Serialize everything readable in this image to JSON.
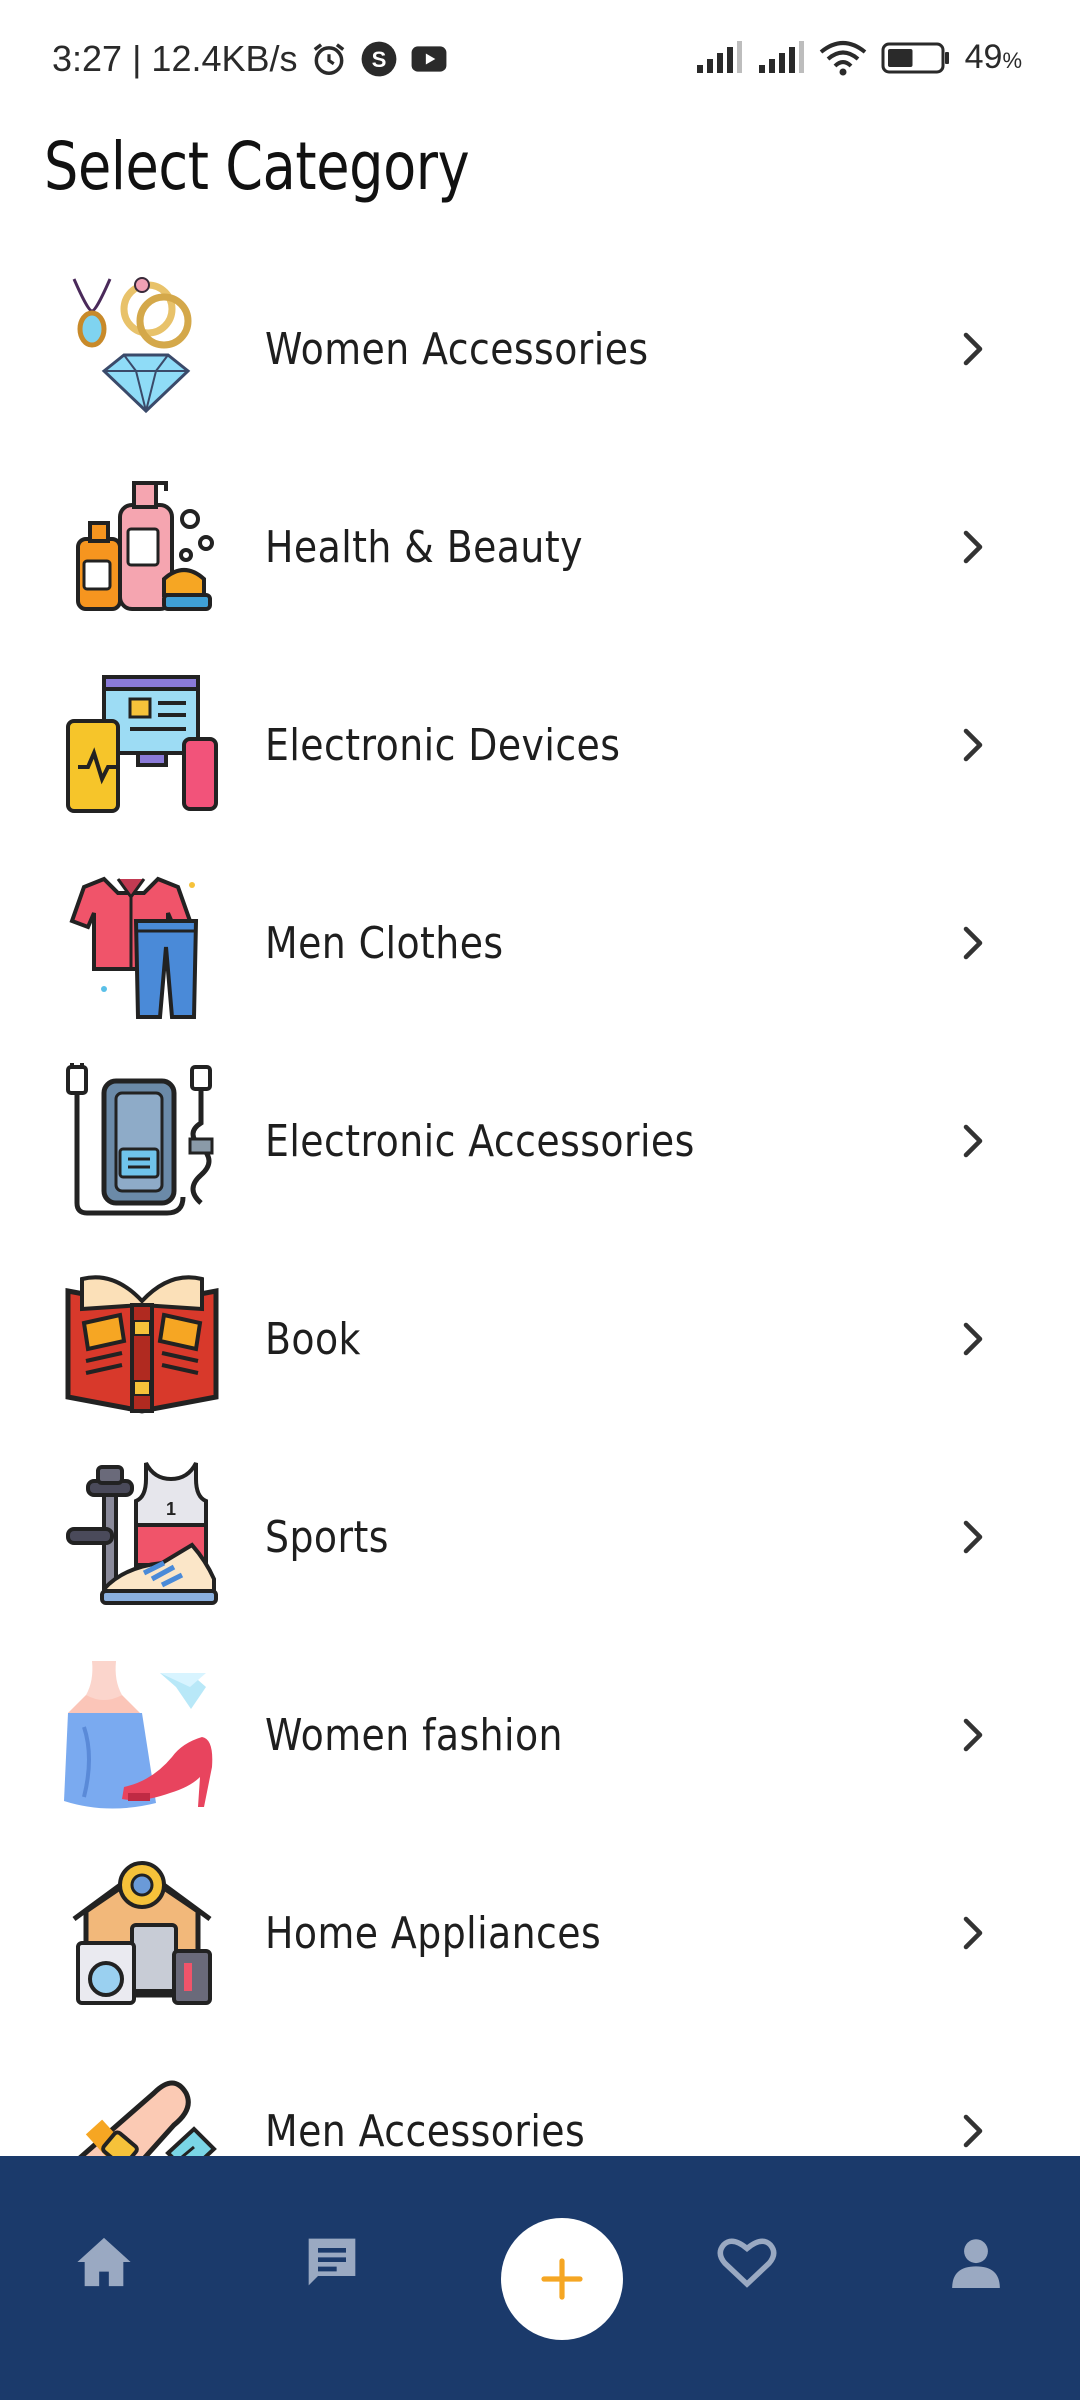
{
  "status_bar": {
    "time_speed": "3:27 | 12.4KB/s",
    "battery_percent": "49",
    "battery_unit": "%",
    "battery_level": 0.49,
    "icons": [
      "alarm-icon",
      "s-app-icon",
      "youtube-icon",
      "signal-icon",
      "signal-icon",
      "wifi-icon",
      "battery-icon"
    ]
  },
  "header": {
    "title": "Select Category"
  },
  "categories": [
    {
      "label": "Women Accessories",
      "icon": "jewelry-icon"
    },
    {
      "label": "Health & Beauty",
      "icon": "cosmetics-icon"
    },
    {
      "label": "Electronic Devices",
      "icon": "devices-icon"
    },
    {
      "label": "Men Clothes",
      "icon": "shirt-jeans-icon"
    },
    {
      "label": "Electronic Accessories",
      "icon": "power-bank-icon"
    },
    {
      "label": "Book",
      "icon": "book-icon"
    },
    {
      "label": "Sports",
      "icon": "sports-icon"
    },
    {
      "label": "Women fashion",
      "icon": "dress-heel-icon"
    },
    {
      "label": "Home Appliances",
      "icon": "home-appliances-icon"
    },
    {
      "label": "Men Accessories",
      "icon": "watch-icon"
    }
  ],
  "bottom_nav": {
    "items": [
      "home-icon",
      "chat-icon",
      "add-icon",
      "heart-icon",
      "profile-icon"
    ],
    "colors": {
      "background": "#1b3a6b",
      "icon": "#9aa9c2",
      "accent": "#f5a623"
    }
  }
}
